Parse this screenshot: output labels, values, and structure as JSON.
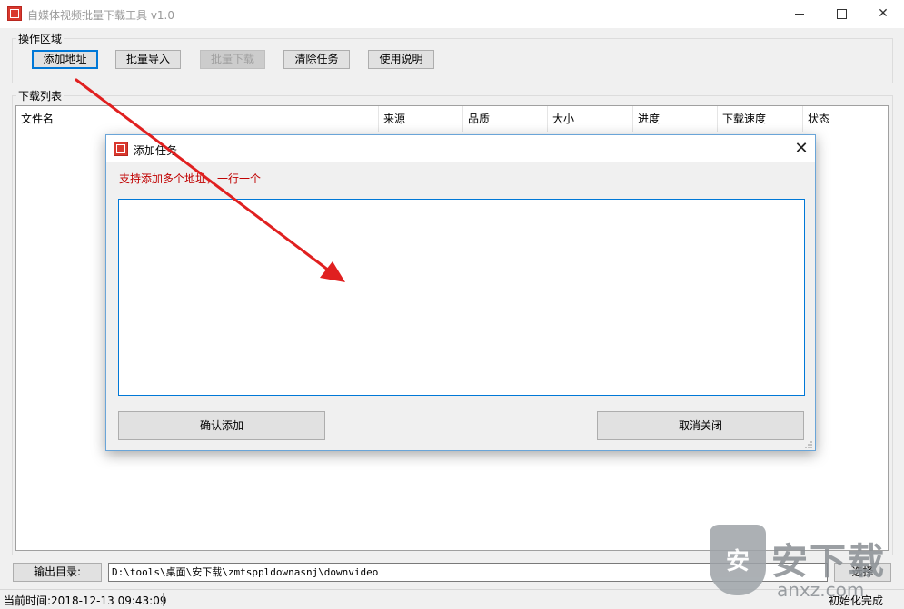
{
  "window": {
    "title": "自媒体视频批量下载工具 v1.0",
    "minimize": "minimize",
    "maximize": "maximize",
    "close": "✕"
  },
  "ops": {
    "group_label": "操作区域",
    "buttons": [
      {
        "label": "添加地址"
      },
      {
        "label": "批量导入"
      },
      {
        "label": "批量下载"
      },
      {
        "label": "清除任务"
      },
      {
        "label": "使用说明"
      }
    ]
  },
  "list": {
    "group_label": "下载列表",
    "columns": [
      "文件名",
      "来源",
      "品质",
      "大小",
      "进度",
      "下载速度",
      "状态"
    ]
  },
  "output": {
    "label": "输出目录:",
    "path": "D:\\tools\\桌面\\安下载\\zmtsppldownasnj\\downvideo",
    "choose_label": "选择"
  },
  "status": {
    "time": "当前时间:2018-12-13 09:43:09",
    "message": "初始化完成"
  },
  "dialog": {
    "title": "添加任务",
    "close": "✕",
    "hint": "支持添加多个地址，一行一个",
    "textarea_value": "",
    "confirm_label": "确认添加",
    "cancel_label": "取消关闭"
  },
  "watermark": {
    "shield_char": "安",
    "big_text": "安下载",
    "small_text": "anxz.com"
  },
  "colors": {
    "accent": "#0078d7",
    "hint_red": "#c00000",
    "arrow_red": "#e02020"
  }
}
